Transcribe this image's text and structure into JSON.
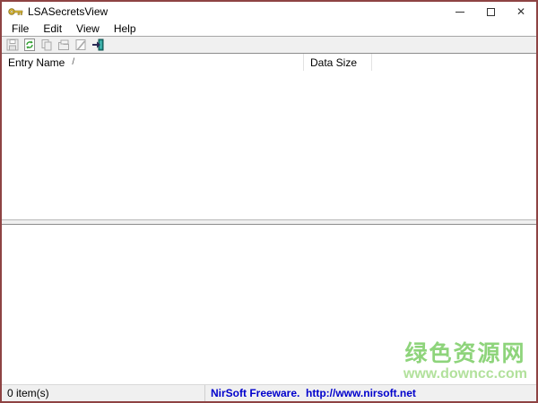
{
  "window": {
    "title": "LSASecretsView",
    "controls": {
      "close_glyph": "✕"
    }
  },
  "menu": {
    "items": [
      "File",
      "Edit",
      "View",
      "Help"
    ]
  },
  "toolbar": {
    "icons": [
      "save",
      "refresh",
      "copy",
      "properties",
      "report",
      "exit"
    ]
  },
  "list": {
    "columns": [
      {
        "label": "Entry Name",
        "sort_indicator": "/"
      },
      {
        "label": "Data Size"
      }
    ],
    "rows": []
  },
  "statusbar": {
    "items_count": "0 item(s)",
    "freeware_text": "NirSoft Freeware.  http://www.nirsoft.net"
  },
  "watermark": {
    "title": "绿色资源网",
    "url": "www.downcc.com"
  },
  "colors": {
    "window_border": "#8e4343",
    "toolbar_bg": "#f0f0f0",
    "status_link": "#0000cc",
    "watermark_green": "#8ed47b",
    "watermark_green_light": "#b2e19c"
  }
}
